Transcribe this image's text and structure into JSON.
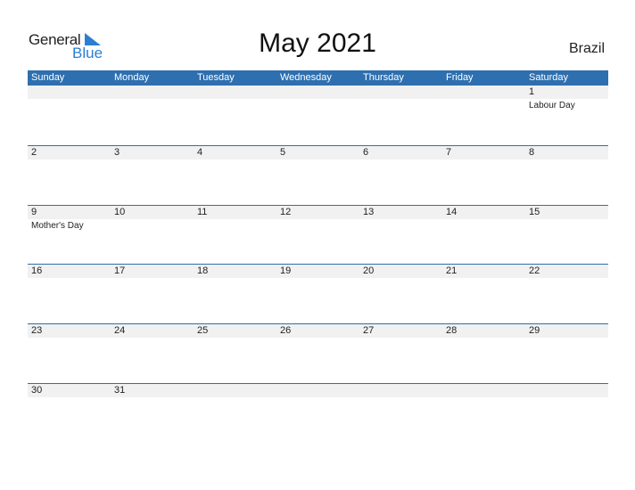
{
  "logo": {
    "general": "General",
    "blue": "Blue"
  },
  "title": "May 2021",
  "country": "Brazil",
  "weekdays": [
    "Sunday",
    "Monday",
    "Tuesday",
    "Wednesday",
    "Thursday",
    "Friday",
    "Saturday"
  ],
  "weeks": [
    [
      {
        "d": ""
      },
      {
        "d": ""
      },
      {
        "d": ""
      },
      {
        "d": ""
      },
      {
        "d": ""
      },
      {
        "d": ""
      },
      {
        "d": "1",
        "h": "Labour Day"
      }
    ],
    [
      {
        "d": "2"
      },
      {
        "d": "3"
      },
      {
        "d": "4"
      },
      {
        "d": "5"
      },
      {
        "d": "6"
      },
      {
        "d": "7"
      },
      {
        "d": "8"
      }
    ],
    [
      {
        "d": "9",
        "h": "Mother's Day"
      },
      {
        "d": "10"
      },
      {
        "d": "11"
      },
      {
        "d": "12"
      },
      {
        "d": "13"
      },
      {
        "d": "14"
      },
      {
        "d": "15"
      }
    ],
    [
      {
        "d": "16"
      },
      {
        "d": "17"
      },
      {
        "d": "18"
      },
      {
        "d": "19"
      },
      {
        "d": "20"
      },
      {
        "d": "21"
      },
      {
        "d": "22"
      }
    ],
    [
      {
        "d": "23"
      },
      {
        "d": "24"
      },
      {
        "d": "25"
      },
      {
        "d": "26"
      },
      {
        "d": "27"
      },
      {
        "d": "28"
      },
      {
        "d": "29"
      }
    ],
    [
      {
        "d": "30"
      },
      {
        "d": "31"
      },
      {
        "d": ""
      },
      {
        "d": ""
      },
      {
        "d": ""
      },
      {
        "d": ""
      },
      {
        "d": ""
      }
    ]
  ],
  "colors": {
    "accent": "#2e6fb0",
    "logo_blue": "#2a7fd0",
    "band": "#f1f1f1"
  }
}
